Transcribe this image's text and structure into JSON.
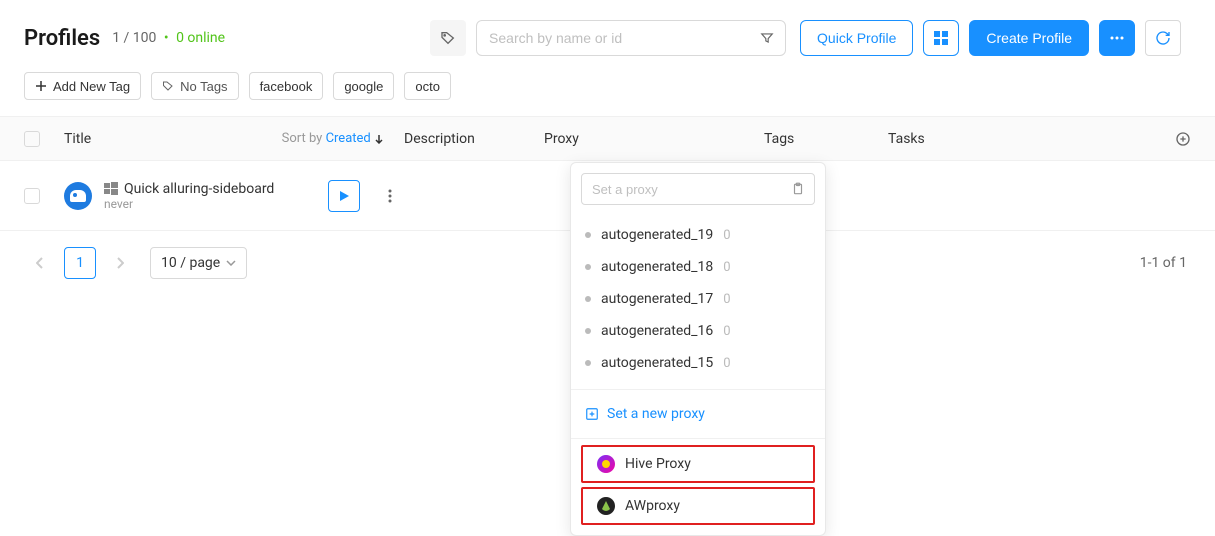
{
  "header": {
    "title": "Profiles",
    "count": "1 / 100",
    "online": "0 online",
    "search_placeholder": "Search by name or id",
    "quick_profile": "Quick Profile",
    "create_profile": "Create Profile"
  },
  "tags": {
    "add_new": "Add New Tag",
    "no_tags": "No Tags",
    "list": [
      "facebook",
      "google",
      "octo"
    ]
  },
  "columns": {
    "title": "Title",
    "sortby_prefix": "Sort by",
    "sortby_field": "Created",
    "description": "Description",
    "proxy": "Proxy",
    "tags": "Tags",
    "tasks": "Tasks"
  },
  "rows": [
    {
      "name": "Quick alluring-sideboard",
      "sub": "never"
    }
  ],
  "dropdown": {
    "search_placeholder": "Set a proxy",
    "items": [
      {
        "label": "autogenerated_19",
        "count": "0"
      },
      {
        "label": "autogenerated_18",
        "count": "0"
      },
      {
        "label": "autogenerated_17",
        "count": "0"
      },
      {
        "label": "autogenerated_16",
        "count": "0"
      },
      {
        "label": "autogenerated_15",
        "count": "0"
      }
    ],
    "set_new": "Set a new proxy",
    "providers": [
      {
        "name": "Hive Proxy"
      },
      {
        "name": "AWproxy"
      }
    ]
  },
  "pagination": {
    "current": "1",
    "per_page": "10 / page",
    "range": "1-1 of 1"
  }
}
